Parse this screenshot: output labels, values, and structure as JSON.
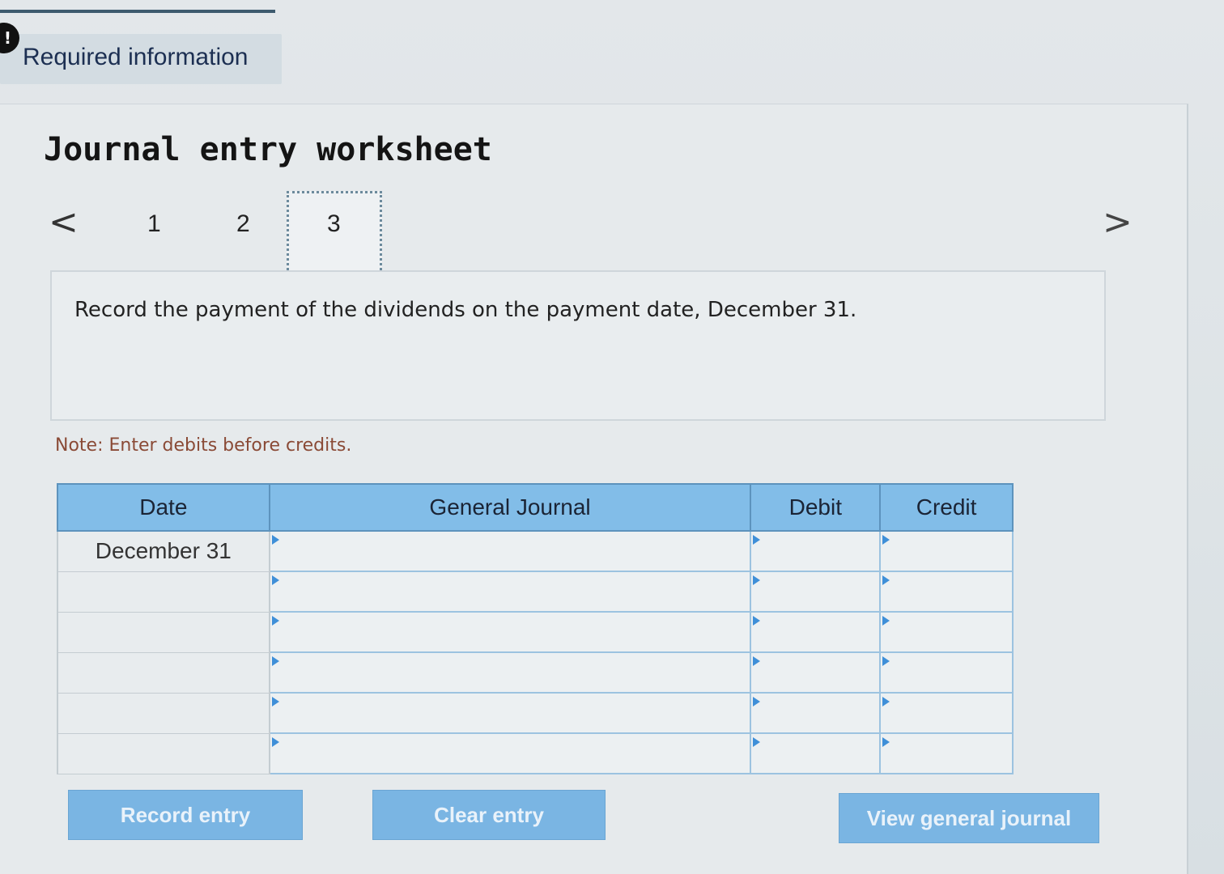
{
  "header": {
    "badge": "!",
    "required_label": "Required information"
  },
  "worksheet": {
    "title": "Journal entry worksheet",
    "nav": {
      "prev": "<",
      "next": ">",
      "steps": [
        "1",
        "2",
        "3"
      ],
      "active_step": "3"
    },
    "prompt": "Record the payment of the dividends on the payment date, December 31.",
    "note": "Note: Enter debits before credits."
  },
  "journal": {
    "columns": [
      "Date",
      "General Journal",
      "Debit",
      "Credit"
    ],
    "rows": [
      {
        "date": "December 31",
        "account": "",
        "debit": "",
        "credit": ""
      },
      {
        "date": "",
        "account": "",
        "debit": "",
        "credit": ""
      },
      {
        "date": "",
        "account": "",
        "debit": "",
        "credit": ""
      },
      {
        "date": "",
        "account": "",
        "debit": "",
        "credit": ""
      },
      {
        "date": "",
        "account": "",
        "debit": "",
        "credit": ""
      },
      {
        "date": "",
        "account": "",
        "debit": "",
        "credit": ""
      }
    ]
  },
  "buttons": {
    "record": "Record entry",
    "clear": "Clear entry",
    "view": "View general journal"
  },
  "colors": {
    "header_blue": "#82bde8",
    "button_blue": "#7ab5e3",
    "note_color": "#8a4a36"
  }
}
